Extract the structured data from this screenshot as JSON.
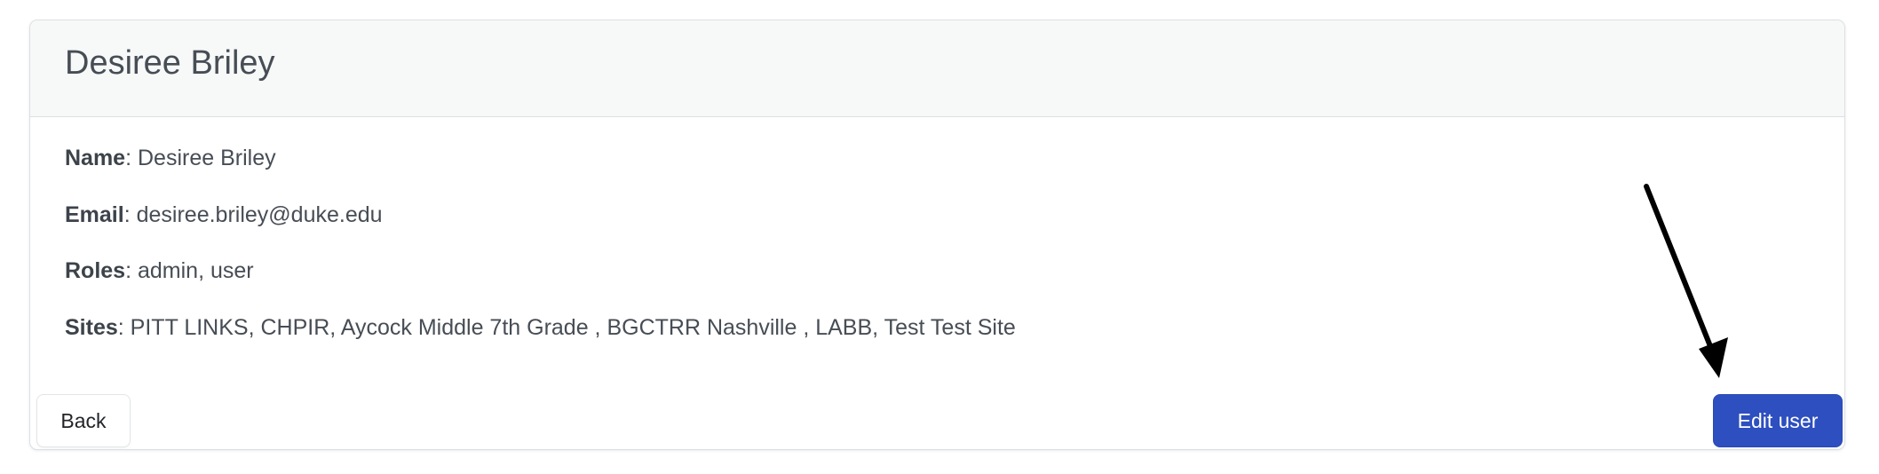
{
  "card": {
    "title": "Desiree Briley"
  },
  "details": {
    "name": {
      "label": "Name",
      "value": "Desiree Briley"
    },
    "email": {
      "label": "Email",
      "value": "desiree.briley@duke.edu"
    },
    "roles": {
      "label": "Roles",
      "value": "admin, user"
    },
    "sites": {
      "label": "Sites",
      "value": "PITT LINKS, CHPIR, Aycock Middle 7th Grade , BGCTRR Nashville , LABB, Test Test Site"
    }
  },
  "actions": {
    "back_label": "Back",
    "edit_label": "Edit user"
  },
  "colors": {
    "primary_button": "#2d4fbf",
    "header_background": "#f7f8f8",
    "annotation_arrow": "#000000"
  }
}
